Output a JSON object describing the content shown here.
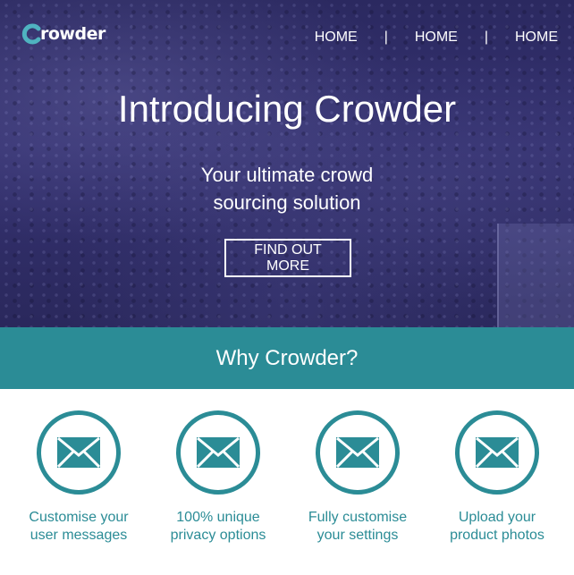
{
  "brand": {
    "logo_text": "rowder",
    "logo_mark": "C",
    "accent_color": "#2b8c96",
    "hero_overlay_color": "#2c2a5e"
  },
  "nav": {
    "items": [
      {
        "label": "HOME"
      },
      {
        "label": "HOME"
      },
      {
        "label": "HOME"
      }
    ],
    "separator": "|"
  },
  "hero": {
    "title": "Introducing Crowder",
    "subtitle_line1": "Your ultimate crowd",
    "subtitle_line2": "sourcing solution",
    "cta_label": "FIND OUT MORE"
  },
  "why": {
    "title": "Why Crowder?"
  },
  "features": [
    {
      "icon": "envelope-icon",
      "line1": "Customise your",
      "line2": "user messages"
    },
    {
      "icon": "envelope-icon",
      "line1": "100% unique",
      "line2": "privacy options"
    },
    {
      "icon": "envelope-icon",
      "line1": "Fully customise",
      "line2": "your settings"
    },
    {
      "icon": "envelope-icon",
      "line1": "Upload your",
      "line2": "product photos"
    }
  ]
}
